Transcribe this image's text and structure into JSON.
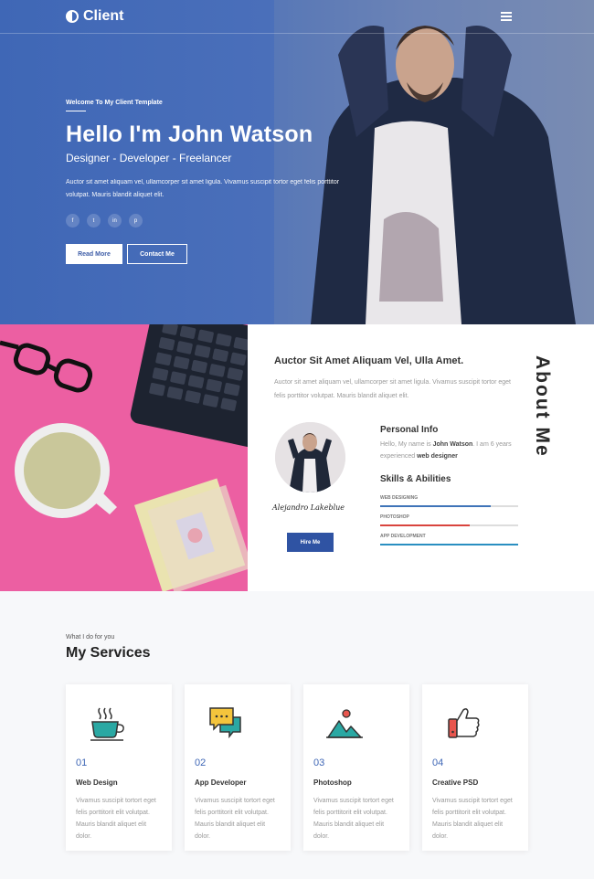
{
  "brand": {
    "name": "Client"
  },
  "hero": {
    "welcome": "Welcome To My Client Template",
    "title": "Hello I'm John Watson",
    "subtitle": "Designer - Developer - Freelancer",
    "description": "Auctor sit amet aliquam vel, ullamcorper sit amet ligula. Vivamus suscipit tortor eget felis porttitor volutpat. Mauris blandit aliquet elit.",
    "socials": [
      {
        "icon": "facebook-icon",
        "glyph": "f"
      },
      {
        "icon": "twitter-icon",
        "glyph": "t"
      },
      {
        "icon": "linkedin-icon",
        "glyph": "in"
      },
      {
        "icon": "pinterest-icon",
        "glyph": "p"
      }
    ],
    "read_more": "Read More",
    "contact": "Contact Me"
  },
  "about": {
    "heading": "Auctor Sit Amet Aliquam Vel, Ulla Amet.",
    "description": "Auctor sit amet aliquam vel, ullamcorper sit amet ligula. Vivamus suscipit tortor eget felis porttitor volutpat. Mauris blandit aliquet elit.",
    "section_label": "About Me",
    "signature": "Alejandro Lakeblue",
    "hire": "Hire Me",
    "info_title": "Personal Info",
    "info_prefix": "Hello, My name is",
    "info_name": "John Watson",
    "info_mid": ". I am 6 years experienced",
    "info_role": "web designer",
    "skills_title": "Skills & Abilities",
    "skills": [
      {
        "label": "WEB DESIGNING",
        "level": 0.8,
        "color": "#3f74b8"
      },
      {
        "label": "PHOTOSHOP",
        "level": 0.65,
        "color": "#d9443e"
      },
      {
        "label": "APP DEVELOPMENT",
        "level": 1.0,
        "color": "#2a8fc1"
      }
    ]
  },
  "services": {
    "kicker": "What I do for you",
    "title": "My Services",
    "items": [
      {
        "num": "01",
        "title": "Web Design",
        "desc": "Vivamus suscipit tortort eget felis porttitorit elit volutpat. Mauris blandit aliquet elit dolor.",
        "icon": "coffee-cup-icon"
      },
      {
        "num": "02",
        "title": "App Developer",
        "desc": "Vivamus suscipit tortort eget felis porttitorit elit volutpat. Mauris blandit aliquet elit dolor.",
        "icon": "chat-bubbles-icon"
      },
      {
        "num": "03",
        "title": "Photoshop",
        "desc": "Vivamus suscipit tortort eget felis porttitorit elit volutpat. Mauris blandit aliquet elit dolor.",
        "icon": "mountain-icon"
      },
      {
        "num": "04",
        "title": "Creative PSD",
        "desc": "Vivamus suscipit tortort eget felis porttitorit elit volutpat. Mauris blandit aliquet elit dolor.",
        "icon": "thumbs-up-icon"
      }
    ]
  }
}
